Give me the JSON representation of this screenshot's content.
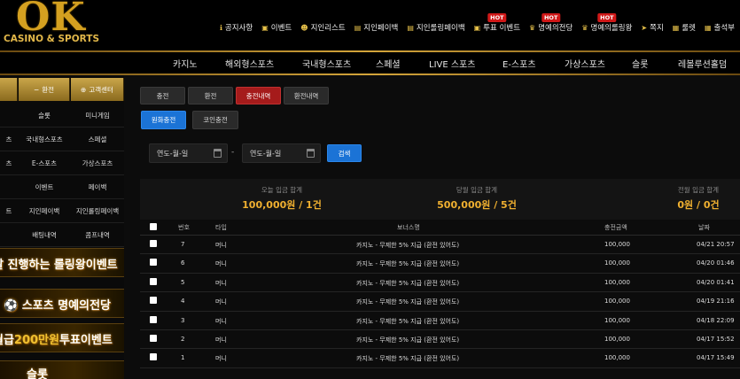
{
  "brand": {
    "logo_text": "OK",
    "logo_sub": "CASINO & SPORTS"
  },
  "top_nav": [
    {
      "icon": "info-icon",
      "glyph": "ℹ",
      "label": "공지사항",
      "hot": ""
    },
    {
      "icon": "gift-icon",
      "glyph": "▣",
      "label": "이벤트",
      "hot": ""
    },
    {
      "icon": "users-icon",
      "glyph": "☻",
      "label": "지인리스트",
      "hot": ""
    },
    {
      "icon": "doc-icon",
      "glyph": "▤",
      "label": "지인페이백",
      "hot": ""
    },
    {
      "icon": "doc-icon",
      "glyph": "▤",
      "label": "지인롤링페이백",
      "hot": ""
    },
    {
      "icon": "gift-icon",
      "glyph": "▣",
      "label": "투표 이벤트",
      "hot": "HOT"
    },
    {
      "icon": "trophy-icon",
      "glyph": "♛",
      "label": "명예의전당",
      "hot": "HOT"
    },
    {
      "icon": "trophy-icon",
      "glyph": "♛",
      "label": "명예의롤링왕",
      "hot": "HOT"
    },
    {
      "icon": "send-icon",
      "glyph": "➤",
      "label": "쪽지",
      "hot": ""
    },
    {
      "icon": "slot-icon",
      "glyph": "▦",
      "label": "룰렛",
      "hot": ""
    },
    {
      "icon": "calendar-icon",
      "glyph": "▦",
      "label": "출석부",
      "hot": ""
    }
  ],
  "main_nav": [
    "카지노",
    "해외형스포츠",
    "국내형스포츠",
    "스페셜",
    "LIVE 스포츠",
    "E-스포츠",
    "가상스포츠",
    "슬롯",
    "레볼루션홀덤"
  ],
  "sidebar": {
    "top_tabs": [
      "",
      "환전",
      "고객센터"
    ],
    "grid": [
      [
        "",
        "슬롯",
        "미니게임"
      ],
      [
        "츠",
        "국내형스포츠",
        "스페셜"
      ],
      [
        "츠",
        "E-스포츠",
        "가상스포츠"
      ],
      [
        "",
        "이벤트",
        "페이백"
      ],
      [
        "트",
        "지인페이백",
        "지인롤링페이백"
      ],
      [
        "",
        "배팅내역",
        "콤프내역"
      ]
    ],
    "banners": [
      {
        "text": "달 진행하는 롤링왕이벤트",
        "highlight": ""
      },
      {
        "text": "스포츠 명예의전당",
        "highlight": ""
      },
      {
        "text": "월급",
        "highlight": "200만원",
        "rest": "투표이벤트"
      },
      {
        "text": "슬롯",
        "highlight": ""
      }
    ]
  },
  "tabs": [
    "충전",
    "환전",
    "충전내역",
    "환전내역"
  ],
  "active_tab": "충전내역",
  "subtabs": [
    "원화충전",
    "코인충전"
  ],
  "active_subtab": "원화충전",
  "date_filter": {
    "from": "연도-월-일",
    "separator": "-",
    "to": "연도-월-일",
    "search_label": "검색"
  },
  "summary": [
    {
      "label": "오늘 입금 합계",
      "value": "100,000원 / 1건"
    },
    {
      "label": "당월 입금 합계",
      "value": "500,000원 / 5건"
    },
    {
      "label": "전월 입금 합계",
      "value": "0원 / 0건"
    }
  ],
  "table": {
    "headers": [
      "번호",
      "타입",
      "보너스명",
      "충전금액",
      "날짜"
    ],
    "rows": [
      {
        "no": "7",
        "type": "머니",
        "bonus": "카지노 - 무제한 5% 지급 (환전 있어도)",
        "amount": "100,000",
        "date": "04/21 20:57"
      },
      {
        "no": "6",
        "type": "머니",
        "bonus": "카지노 - 무제한 5% 지급 (환전 있어도)",
        "amount": "100,000",
        "date": "04/20 01:46"
      },
      {
        "no": "5",
        "type": "머니",
        "bonus": "카지노 - 무제한 5% 지급 (환전 있어도)",
        "amount": "100,000",
        "date": "04/20 01:41"
      },
      {
        "no": "4",
        "type": "머니",
        "bonus": "카지노 - 무제한 5% 지급 (환전 있어도)",
        "amount": "100,000",
        "date": "04/19 21:16"
      },
      {
        "no": "3",
        "type": "머니",
        "bonus": "카지노 - 무제한 5% 지급 (환전 있어도)",
        "amount": "100,000",
        "date": "04/18 22:09"
      },
      {
        "no": "2",
        "type": "머니",
        "bonus": "카지노 - 무제한 5% 지급 (환전 있어도)",
        "amount": "100,000",
        "date": "04/17 15:52"
      },
      {
        "no": "1",
        "type": "머니",
        "bonus": "카지노 - 무제한 5% 지급 (환전 있어도)",
        "amount": "100,000",
        "date": "04/17 15:49"
      }
    ]
  }
}
